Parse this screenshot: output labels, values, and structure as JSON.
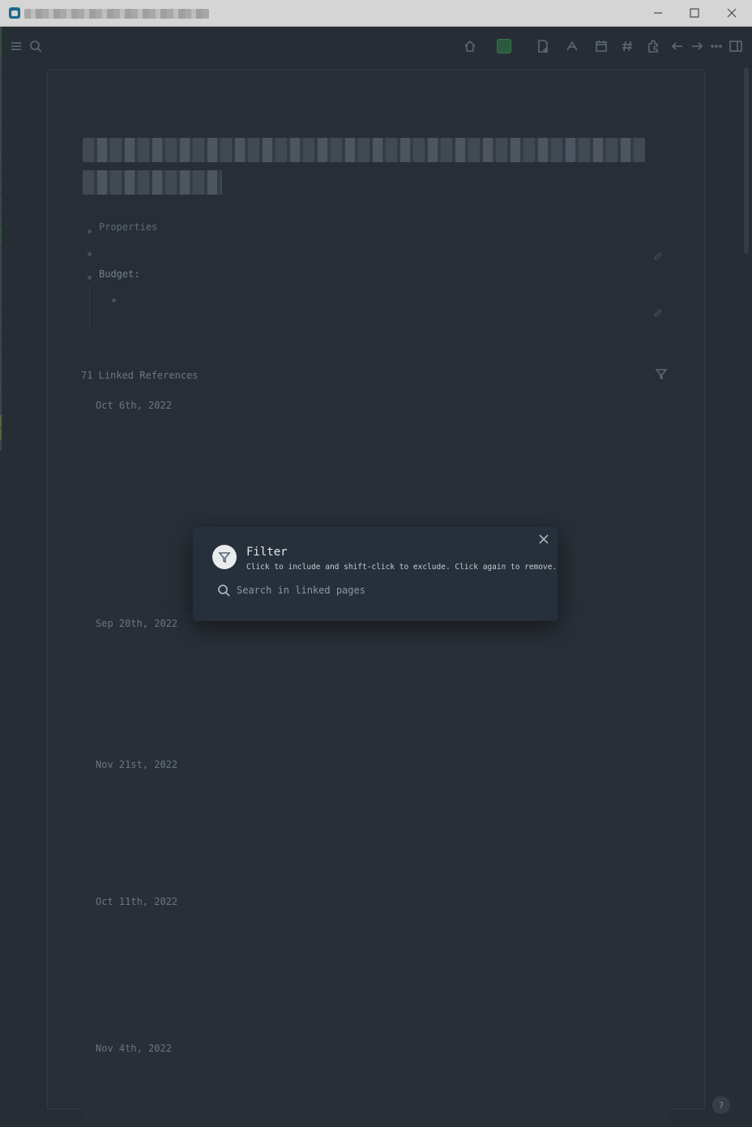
{
  "window": {
    "min_icon": "minimize-icon",
    "max_icon": "maximize-icon",
    "close_icon": "close-icon"
  },
  "toolbar": {
    "left_icons": [
      "menu-icon",
      "search-icon"
    ],
    "right_icons": [
      "home-icon",
      "sync-status-icon",
      "new-page-icon",
      "all-pages-icon",
      "journals-icon",
      "tags-icon",
      "plugins-icon",
      "back-icon",
      "forward-icon",
      "more-icon",
      "sidebar-toggle-icon"
    ],
    "sync_color": "#2f6b46"
  },
  "page": {
    "properties_label": "Properties",
    "budget_label": "Budget:",
    "linked_refs_label": "71 Linked References",
    "ref_dates": [
      "Oct 6th, 2022",
      "Sep 20th, 2022",
      "Nov 21st, 2022",
      "Oct 11th, 2022",
      "Nov 4th, 2022"
    ]
  },
  "filter_popup": {
    "title": "Filter",
    "hint": "Click to include and shift-click to exclude. Click again to remove.",
    "search_placeholder": "Search in linked pages"
  },
  "help": {
    "label": "?"
  }
}
